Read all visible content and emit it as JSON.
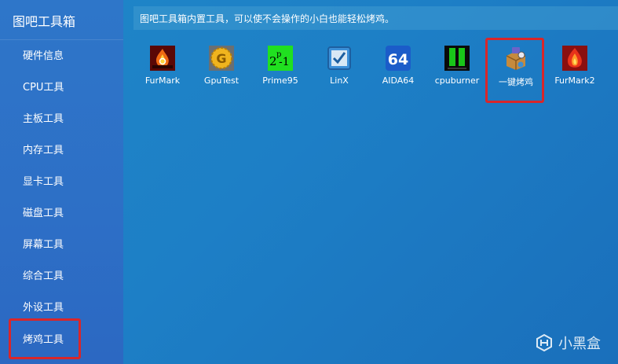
{
  "sidebar": {
    "title": "图吧工具箱",
    "items": [
      {
        "label": "硬件信息"
      },
      {
        "label": "CPU工具"
      },
      {
        "label": "主板工具"
      },
      {
        "label": "内存工具"
      },
      {
        "label": "显卡工具"
      },
      {
        "label": "磁盘工具"
      },
      {
        "label": "屏幕工具"
      },
      {
        "label": "综合工具"
      },
      {
        "label": "外设工具"
      },
      {
        "label": "烤鸡工具"
      }
    ],
    "selected": "烤鸡工具"
  },
  "notice": "图吧工具箱内置工具，可以使不会操作的小白也能轻松烤鸡。",
  "apps": [
    {
      "label": "FurMark",
      "icon": "furmark-icon"
    },
    {
      "label": "GpuTest",
      "icon": "gputest-icon"
    },
    {
      "label": "Prime95",
      "icon": "prime95-icon"
    },
    {
      "label": "LinX",
      "icon": "linx-icon"
    },
    {
      "label": "AIDA64",
      "icon": "aida64-icon",
      "icon_text": "64"
    },
    {
      "label": "cpuburner",
      "icon": "cpuburner-icon"
    },
    {
      "label": "一键烤鸡",
      "icon": "one-click-burn-icon"
    },
    {
      "label": "FurMark2",
      "icon": "furmark2-icon"
    }
  ],
  "watermark": "小黑盒",
  "colors": {
    "highlight": "#d9262a",
    "sidebar": "#2e76c9",
    "background": "#1d7fc6"
  }
}
